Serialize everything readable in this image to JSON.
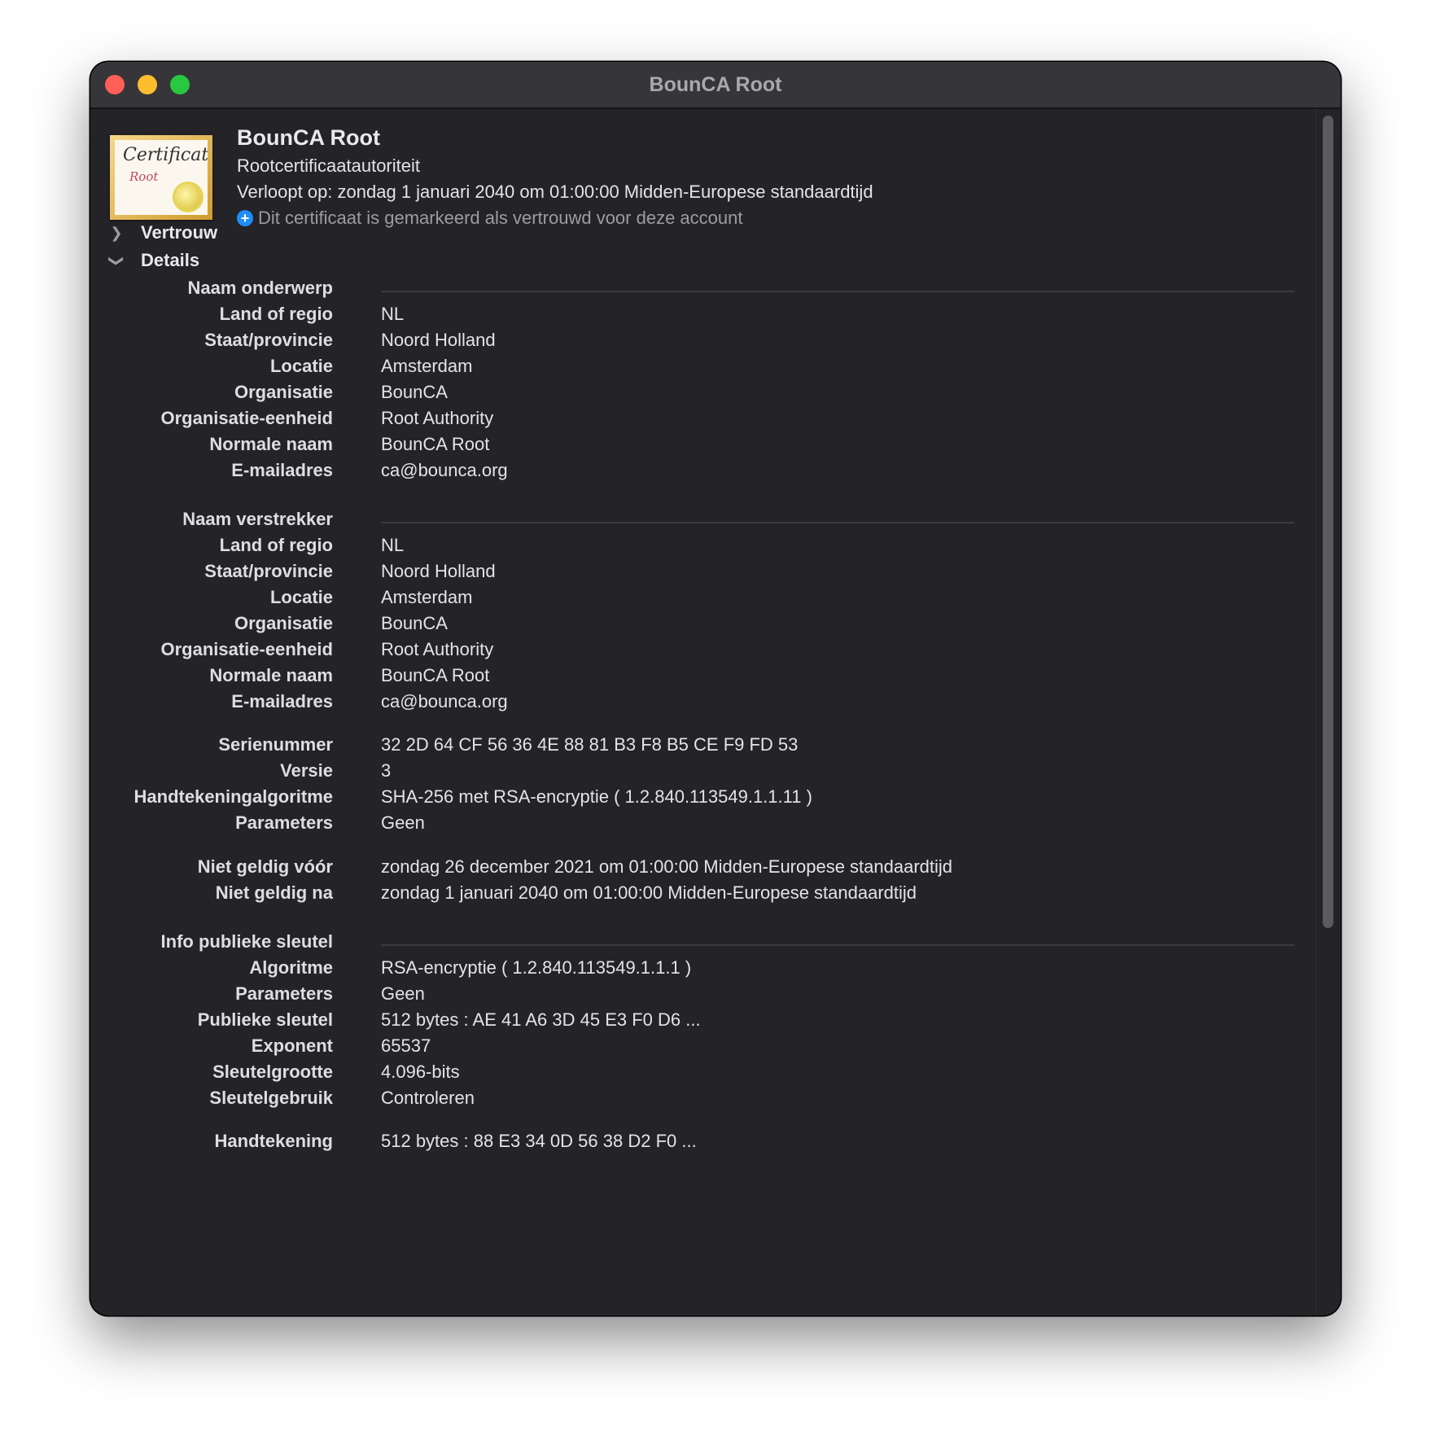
{
  "window": {
    "title": "BounCA Root"
  },
  "header": {
    "title": "BounCA Root",
    "subtitle": "Rootcertificaatautoriteit",
    "expires": "Verloopt op: zondag 1 januari 2040 om 01:00:00 Midden-Europese standaardtijd",
    "trust_note": "Dit certificaat is gemarkeerd als vertrouwd voor deze account",
    "icon_text": "Certificate",
    "icon_subtext": "Root"
  },
  "sections": {
    "trust": "Vertrouw",
    "details": "Details"
  },
  "subject": {
    "heading": "Naam onderwerp",
    "rows": [
      {
        "label": "Land of regio",
        "value": "NL"
      },
      {
        "label": "Staat/provincie",
        "value": "Noord Holland"
      },
      {
        "label": "Locatie",
        "value": "Amsterdam"
      },
      {
        "label": "Organisatie",
        "value": "BounCA"
      },
      {
        "label": "Organisatie-eenheid",
        "value": "Root Authority"
      },
      {
        "label": "Normale naam",
        "value": "BounCA Root"
      },
      {
        "label": "E-mailadres",
        "value": "ca@bounca.org"
      }
    ]
  },
  "issuer": {
    "heading": "Naam verstrekker",
    "rows": [
      {
        "label": "Land of regio",
        "value": "NL"
      },
      {
        "label": "Staat/provincie",
        "value": "Noord Holland"
      },
      {
        "label": "Locatie",
        "value": "Amsterdam"
      },
      {
        "label": "Organisatie",
        "value": "BounCA"
      },
      {
        "label": "Organisatie-eenheid",
        "value": "Root Authority"
      },
      {
        "label": "Normale naam",
        "value": "BounCA Root"
      },
      {
        "label": "E-mailadres",
        "value": "ca@bounca.org"
      }
    ]
  },
  "cert": {
    "rows": [
      {
        "label": "Serienummer",
        "value": "32 2D 64 CF 56 36 4E 88 81 B3 F8 B5 CE F9 FD 53"
      },
      {
        "label": "Versie",
        "value": "3"
      },
      {
        "label": "Handtekeningalgoritme",
        "value": "SHA-256 met RSA-encryptie ( 1.2.840.113549.1.1.11 )"
      },
      {
        "label": "Parameters",
        "value": "Geen"
      }
    ]
  },
  "validity": {
    "rows": [
      {
        "label": "Niet geldig vóór",
        "value": "zondag 26 december 2021 om 01:00:00 Midden-Europese standaardtijd"
      },
      {
        "label": "Niet geldig na",
        "value": "zondag 1 januari 2040 om 01:00:00 Midden-Europese standaardtijd"
      }
    ]
  },
  "pubkey": {
    "heading": "Info publieke sleutel",
    "rows": [
      {
        "label": "Algoritme",
        "value": "RSA-encryptie ( 1.2.840.113549.1.1.1 )"
      },
      {
        "label": "Parameters",
        "value": "Geen"
      },
      {
        "label": "Publieke sleutel",
        "value": "512 bytes : AE 41 A6 3D 45 E3 F0 D6 ..."
      },
      {
        "label": "Exponent",
        "value": "65537"
      },
      {
        "label": "Sleutelgrootte",
        "value": "4.096-bits"
      },
      {
        "label": "Sleutelgebruik",
        "value": "Controleren"
      }
    ]
  },
  "signature": {
    "rows": [
      {
        "label": "Handtekening",
        "value": "512 bytes : 88 E3 34 0D 56 38 D2 F0 ..."
      }
    ]
  },
  "colors": {
    "window_bg": "#242328",
    "titlebar_bg": "#36353a",
    "close": "#ff5f57",
    "minimize": "#febc2e",
    "zoom": "#28c840",
    "trust_icon": "#1e8df5"
  }
}
